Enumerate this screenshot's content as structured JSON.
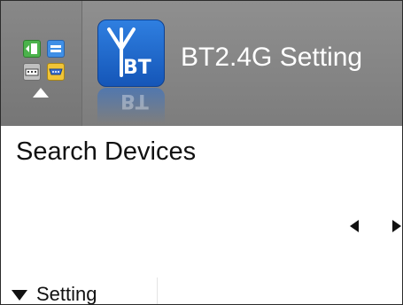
{
  "header": {
    "title": "BT2.4G Setting",
    "app_icon": {
      "label": "BT",
      "name": "bluetooth-antenna-icon"
    },
    "menu_button": {
      "icons": [
        "output-icon",
        "display-icon",
        "keyboard-icon",
        "vga-port-icon"
      ],
      "arrow": "up-arrow-icon"
    },
    "background": "#858585"
  },
  "main": {
    "section_title": "Search Devices",
    "pager": {
      "prev": "left-arrow-icon",
      "next": "right-arrow-icon"
    },
    "setting": {
      "label": "Setting",
      "expander": "triangle-down-icon"
    }
  },
  "colors": {
    "app_icon_blue": "#1f6ad0",
    "text": "#111111",
    "header_text": "#ffffff"
  }
}
